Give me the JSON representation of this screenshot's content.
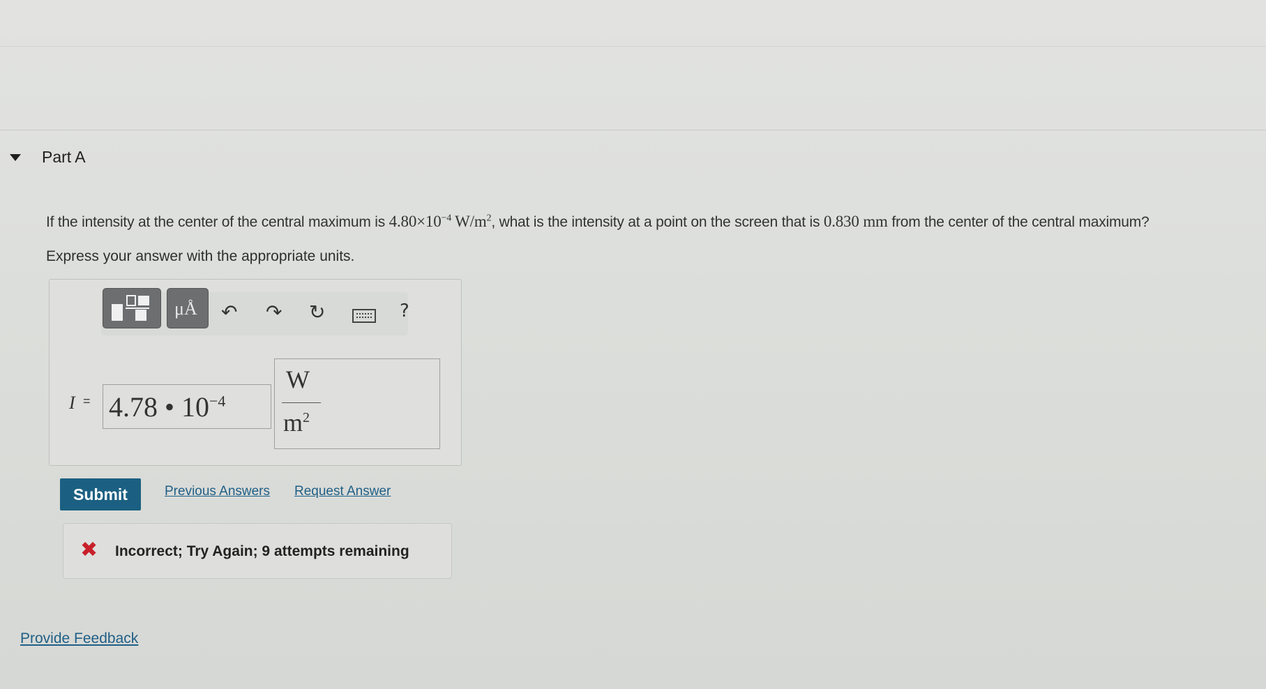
{
  "part": {
    "title": "Part A"
  },
  "question": {
    "prefix": "If the intensity at the center of the central maximum is",
    "intensity_mantissa": "4.80×10",
    "intensity_exponent": "−4",
    "intensity_unit": "W/m",
    "intensity_unit_exponent": "2",
    "middle": ", what is the intensity at a point on the screen that is",
    "distance_value": "0.830",
    "distance_unit": "mm",
    "suffix": "from the center of the central maximum?"
  },
  "instructions": "Express your answer with the appropriate units.",
  "toolbar": {
    "units_label": "μÅ",
    "help_label": "?"
  },
  "answer": {
    "variable": "I",
    "equals": "=",
    "value_mantissa": "4.78 • 10",
    "value_exponent": "−4",
    "unit_numerator": "W",
    "unit_denominator": "m",
    "unit_denominator_exponent": "2"
  },
  "actions": {
    "submit_label": "Submit",
    "previous_answers_label": "Previous Answers",
    "request_answer_label": "Request Answer"
  },
  "feedback": {
    "message": "Incorrect; Try Again; 9 attempts remaining"
  },
  "footer": {
    "provide_feedback_label": "Provide Feedback"
  },
  "colors": {
    "submit_background": "#1b6082",
    "link": "#1f5f86",
    "error": "#c8202a"
  },
  "icons": [
    "templates-icon",
    "units-icon",
    "undo-icon",
    "redo-icon",
    "reset-icon",
    "keyboard-icon",
    "help-icon",
    "incorrect-x-icon",
    "collapse-triangle-icon"
  ]
}
